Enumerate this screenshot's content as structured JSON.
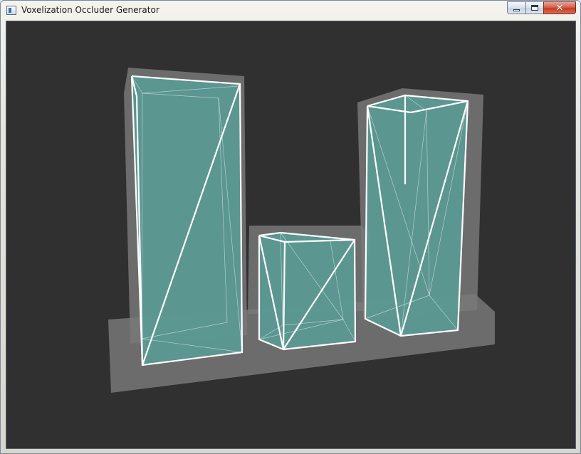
{
  "window": {
    "title": "Voxelization Occluder Generator",
    "icon": "app-window-icon"
  },
  "caption_buttons": {
    "minimize_icon": "minimize-icon",
    "maximize_icon": "maximize-icon",
    "close_label": "✕"
  },
  "scene": {
    "background_color": "#303030",
    "occluder_color": "#7a7a7a",
    "mesh_fill_color": "#5a9a94",
    "wire_color": "#ffffff",
    "objects": [
      "tall-box",
      "small-cube",
      "leaning-box"
    ]
  }
}
